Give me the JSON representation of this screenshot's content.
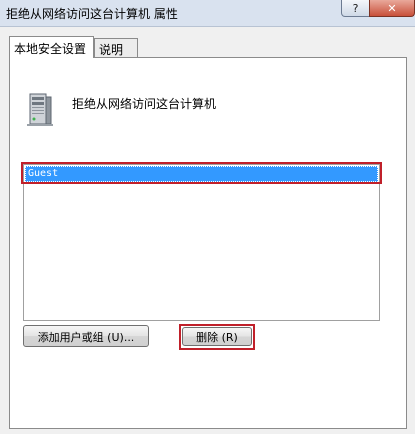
{
  "window": {
    "title": "拒绝从网络访问这台计算机 属性",
    "help_label": "?",
    "close_label": "✕"
  },
  "tabs": [
    {
      "label": "本地安全设置",
      "active": true
    },
    {
      "label": "说明",
      "active": false
    }
  ],
  "policy": {
    "icon": "server-computer-icon",
    "title": "拒绝从网络访问这台计算机"
  },
  "accounts": {
    "items": [
      "Guest"
    ],
    "selected": "Guest"
  },
  "buttons": {
    "add_label": "添加用户或组 (U)...",
    "remove_label": "删除 (R)"
  },
  "colors": {
    "selection": "#3399ff",
    "highlight_box": "#c0202a"
  }
}
